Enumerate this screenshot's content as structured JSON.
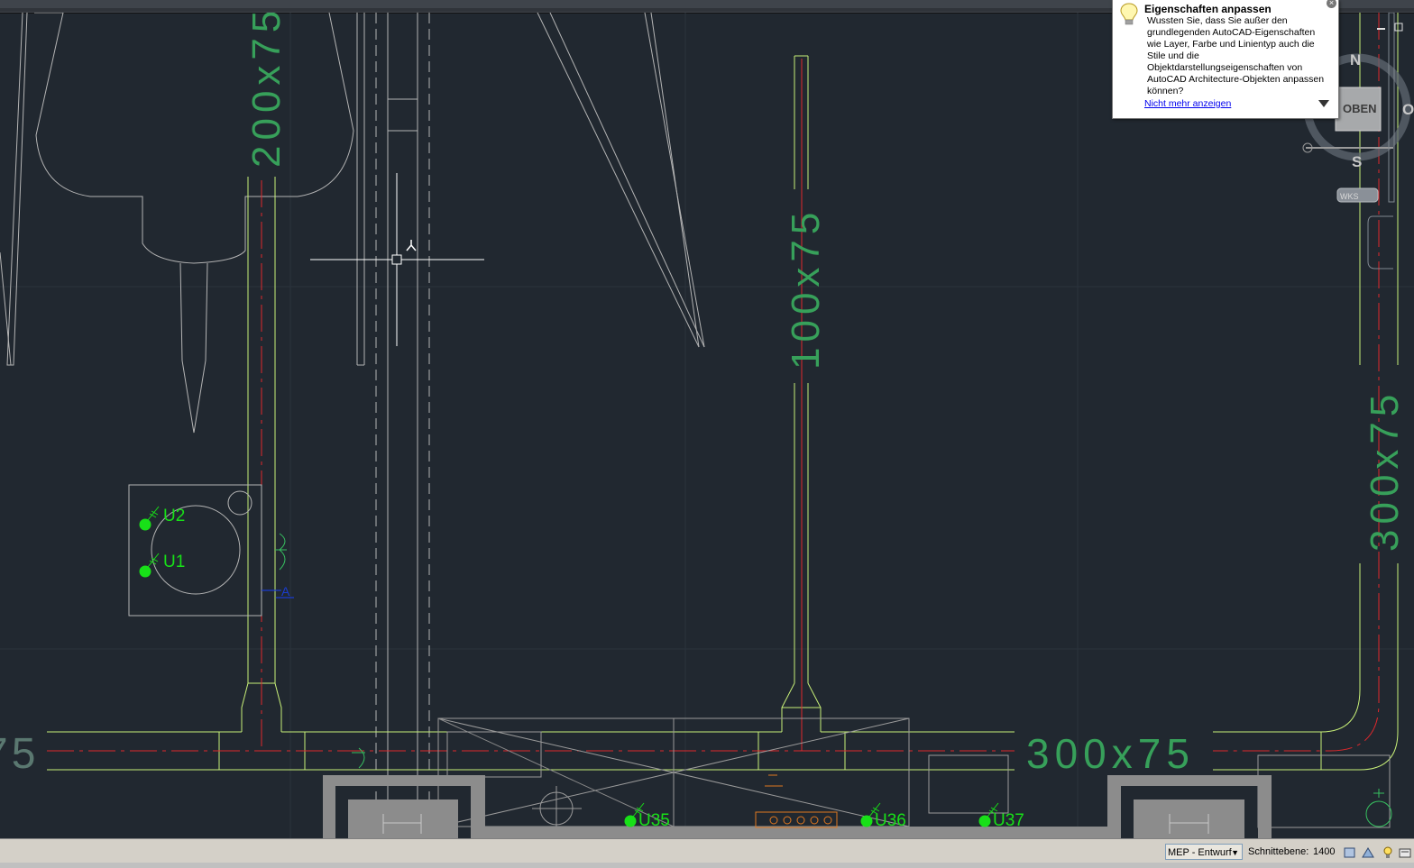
{
  "drawing": {
    "labels": {
      "duct_a": "200x75",
      "duct_b": "100x75",
      "duct_c": "300x75",
      "duct_d": "300x75",
      "duct_e": "75",
      "u1": "U1",
      "u2": "U2",
      "u35": "U35",
      "u36": "U36",
      "u37": "U37",
      "tag_a": "A"
    }
  },
  "viewcube": {
    "north": "N",
    "south": "S",
    "east": "O",
    "face": "OBEN",
    "wcs": "WKS"
  },
  "tooltip": {
    "title": "Eigenschaften anpassen",
    "body": "Wussten Sie, dass Sie außer den grundlegenden AutoCAD-Eigenschaften wie Layer, Farbe und Linientyp auch die Stile und die Objektdarstellungseigenschaften von AutoCAD Architecture-Objekten anpassen können?",
    "link": "Nicht mehr anzeigen",
    "close": "×"
  },
  "statusbar": {
    "workspace": "MEP - Entwurf",
    "cut_plane_label": "Schnittebene:",
    "cut_plane_value": "1400"
  },
  "colors": {
    "background": "#212830",
    "duct_green": "#c8f078",
    "label_green": "#37a05a",
    "centerline_red": "#e0282d",
    "wall_white": "#c8c8c8",
    "marker_green": "#18e018"
  }
}
